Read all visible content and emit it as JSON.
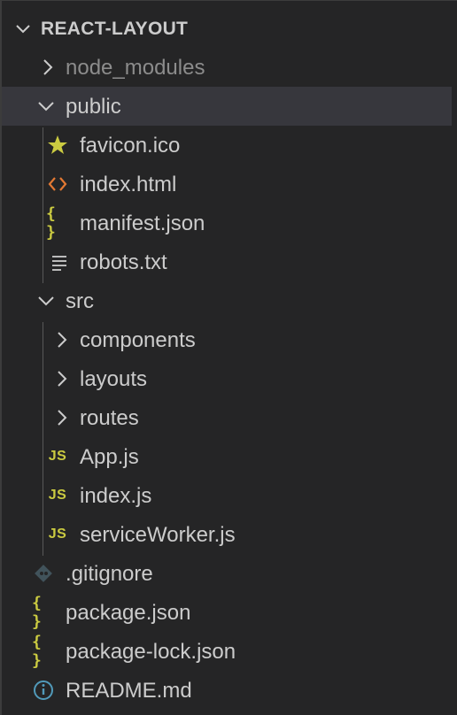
{
  "explorer": {
    "title": "REACT-LAYOUT",
    "items": [
      {
        "label": "node_modules",
        "type": "folder-collapsed",
        "icon": "chevron-right-icon"
      },
      {
        "label": "public",
        "type": "folder-expanded",
        "icon": "chevron-down-icon",
        "selected": true
      },
      {
        "label": "favicon.ico",
        "type": "file",
        "icon": "star-icon"
      },
      {
        "label": "index.html",
        "type": "file",
        "icon": "html-icon"
      },
      {
        "label": "manifest.json",
        "type": "file",
        "icon": "json-icon"
      },
      {
        "label": "robots.txt",
        "type": "file",
        "icon": "text-file-icon"
      },
      {
        "label": "src",
        "type": "folder-expanded",
        "icon": "chevron-down-icon"
      },
      {
        "label": "components",
        "type": "folder-collapsed",
        "icon": "chevron-right-icon"
      },
      {
        "label": "layouts",
        "type": "folder-collapsed",
        "icon": "chevron-right-icon"
      },
      {
        "label": "routes",
        "type": "folder-collapsed",
        "icon": "chevron-right-icon"
      },
      {
        "label": "App.js",
        "type": "file",
        "icon": "js-icon"
      },
      {
        "label": "index.js",
        "type": "file",
        "icon": "js-icon"
      },
      {
        "label": "serviceWorker.js",
        "type": "file",
        "icon": "js-icon"
      },
      {
        "label": ".gitignore",
        "type": "file",
        "icon": "git-icon"
      },
      {
        "label": "package.json",
        "type": "file",
        "icon": "json-icon"
      },
      {
        "label": "package-lock.json",
        "type": "file",
        "icon": "json-icon"
      },
      {
        "label": "README.md",
        "type": "file",
        "icon": "info-icon"
      }
    ],
    "icon_labels": {
      "js": "JS",
      "braces": "{ }"
    },
    "colors": {
      "background": "#252526",
      "selected": "#37373d",
      "text": "#cccccc",
      "dim_text": "#8c8c8c",
      "js_yellow": "#cbcb41",
      "html_orange": "#e37933",
      "info_blue": "#519aba",
      "git_gray": "#41535b"
    }
  }
}
